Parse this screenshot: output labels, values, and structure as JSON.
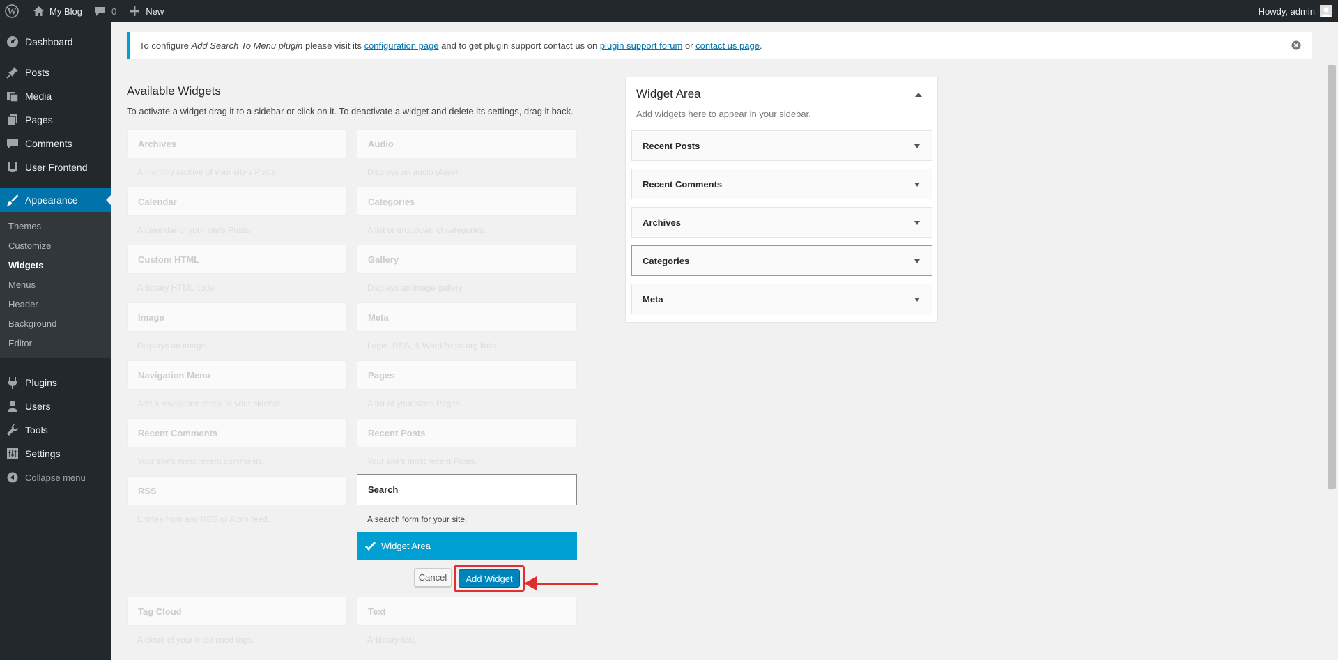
{
  "admin_bar": {
    "site_name": "My Blog",
    "comments_count": "0",
    "new_label": "New",
    "howdy": "Howdy, admin"
  },
  "menu": {
    "dashboard": "Dashboard",
    "posts": "Posts",
    "media": "Media",
    "pages": "Pages",
    "comments": "Comments",
    "user_frontend": "User Frontend",
    "appearance": "Appearance",
    "submenu": [
      "Themes",
      "Customize",
      "Widgets",
      "Menus",
      "Header",
      "Background",
      "Editor"
    ],
    "plugins": "Plugins",
    "users": "Users",
    "tools": "Tools",
    "settings": "Settings",
    "collapse": "Collapse menu"
  },
  "notice": {
    "prefix": "To configure ",
    "plugin_name": "Add Search To Menu plugin",
    "mid1": " please visit its ",
    "link1": "configuration page",
    "mid2": " and to get plugin support contact us on ",
    "link2": "plugin support forum",
    "mid3": " or ",
    "link3": "contact us page",
    "suffix": "."
  },
  "available": {
    "title": "Available Widgets",
    "description": "To activate a widget drag it to a sidebar or click on it. To deactivate a widget and delete its settings, drag it back.",
    "left": [
      {
        "title": "Archives",
        "desc": "A monthly archive of your site's Posts."
      },
      {
        "title": "Calendar",
        "desc": "A calendar of your site's Posts."
      },
      {
        "title": "Custom HTML",
        "desc": "Arbitrary HTML code."
      },
      {
        "title": "Image",
        "desc": "Displays an image."
      },
      {
        "title": "Navigation Menu",
        "desc": "Add a navigation menu to your sidebar."
      },
      {
        "title": "Recent Comments",
        "desc": "Your site's most recent comments."
      },
      {
        "title": "RSS",
        "desc": "Entries from any RSS or Atom feed."
      },
      {
        "title": "Tag Cloud",
        "desc": "A cloud of your most used tags."
      }
    ],
    "right": [
      {
        "title": "Audio",
        "desc": "Displays an audio player."
      },
      {
        "title": "Categories",
        "desc": "A list or dropdown of categories."
      },
      {
        "title": "Gallery",
        "desc": "Displays an image gallery."
      },
      {
        "title": "Meta",
        "desc": "Login, RSS, & WordPress.org links."
      },
      {
        "title": "Pages",
        "desc": "A list of your site's Pages."
      },
      {
        "title": "Recent Posts",
        "desc": "Your site's most recent Posts."
      },
      {
        "title": "Text",
        "desc": "Arbitrary text."
      }
    ],
    "selected": {
      "title": "Search",
      "desc": "A search form for your site.",
      "target": "Widget Area",
      "cancel": "Cancel",
      "add": "Add Widget"
    }
  },
  "widget_area": {
    "title": "Widget Area",
    "description": "Add widgets here to appear in your sidebar.",
    "widgets": [
      "Recent Posts",
      "Recent Comments",
      "Archives",
      "Categories",
      "Meta"
    ]
  }
}
